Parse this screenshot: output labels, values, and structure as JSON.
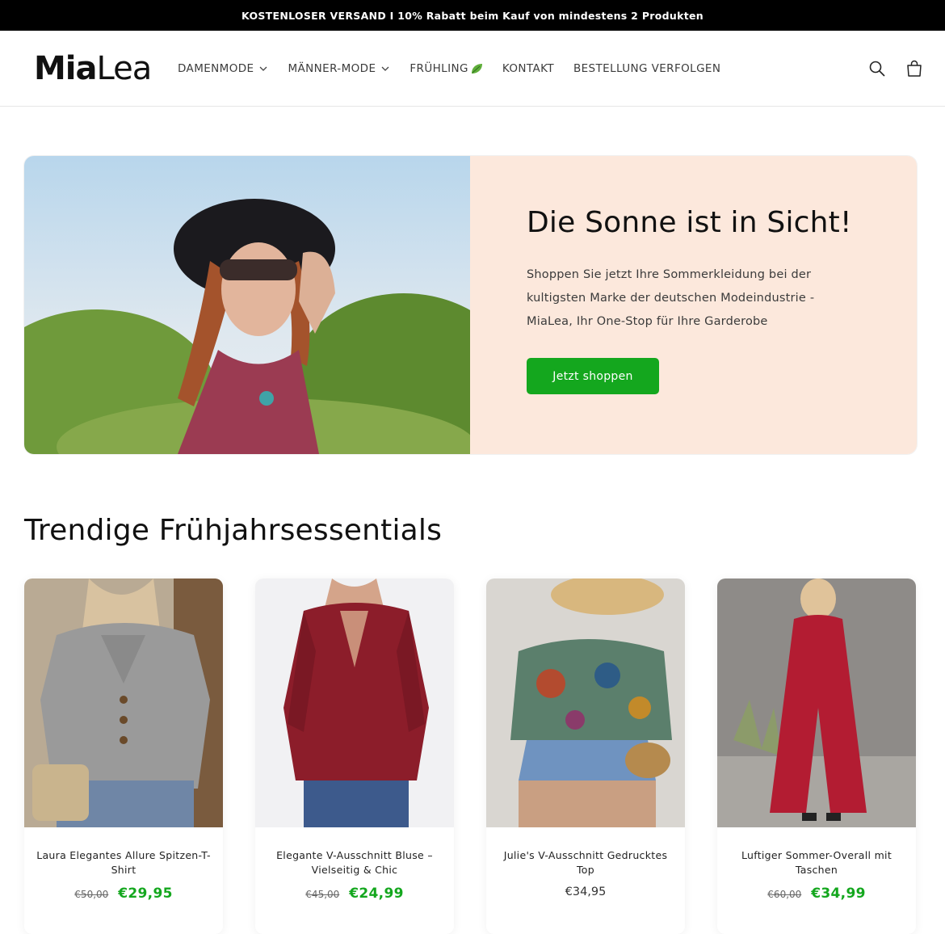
{
  "announcement": "KOSTENLOSER VERSAND I 10% Rabatt beim Kauf von mindestens 2 Produkten",
  "logo": {
    "bold": "Mia",
    "light": "Lea"
  },
  "nav": {
    "items": [
      {
        "label": "DAMENMODE",
        "icon": "chevron-down-icon"
      },
      {
        "label": "MÄNNER-MODE",
        "icon": "chevron-down-icon"
      },
      {
        "label": "FRÜHLING",
        "icon": "leaf-icon"
      },
      {
        "label": "KONTAKT"
      },
      {
        "label": "BESTELLUNG VERFOLGEN"
      }
    ]
  },
  "header_icons": [
    "search-icon",
    "cart-icon"
  ],
  "hero": {
    "title": "Die Sonne ist in Sicht!",
    "body": "Shoppen Sie jetzt Ihre Sommerkleidung bei der kultigsten Marke der deutschen Modeindustrie - MiaLea, Ihr One-Stop für Ihre Garderobe",
    "button": "Jetzt shoppen",
    "bg_color": "#fce8dc",
    "button_color": "#14a71e"
  },
  "section": {
    "title": "Trendige Frühjahrsessentials"
  },
  "products": [
    {
      "title": "Laura Elegantes Allure Spitzen-T-Shirt",
      "old_price": "€50,00",
      "price": "€29,95"
    },
    {
      "title": "Elegante V-Ausschnitt Bluse – Vielseitig & Chic",
      "old_price": "€45,00",
      "price": "€24,99"
    },
    {
      "title": "Julie's V-Ausschnitt Gedrucktes Top",
      "old_price": "",
      "price": "€34,95"
    },
    {
      "title": "Luftiger Sommer-Overall mit Taschen",
      "old_price": "€60,00",
      "price": "€34,99"
    }
  ]
}
